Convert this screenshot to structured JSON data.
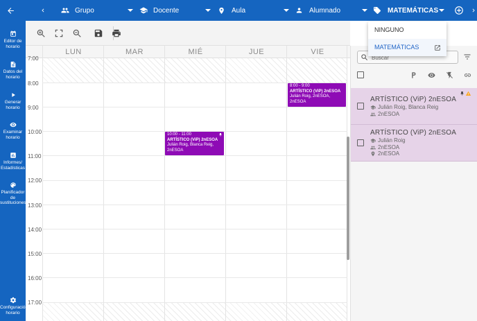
{
  "topbar": {
    "filters": [
      {
        "label": "Grupo",
        "icon": "group-icon"
      },
      {
        "label": "Docente",
        "icon": "school-icon"
      },
      {
        "label": "Aula",
        "icon": "location-pin-icon"
      },
      {
        "label": "Alumnado",
        "icon": "person-icon"
      },
      {
        "label": "MATEMÁTICAS",
        "icon": "tag-icon"
      }
    ]
  },
  "sidebar": {
    "items": [
      {
        "label": "Editor de\nhorario",
        "icon": "calendar-icon"
      },
      {
        "label": "Datos del\nhorario",
        "icon": "document-icon"
      },
      {
        "label": "Generar\nhorario",
        "icon": "play-icon"
      },
      {
        "label": "Examinar\nhorario",
        "icon": "eye-icon"
      },
      {
        "label": "Informes/\nEstadísticas",
        "icon": "chart-icon"
      },
      {
        "label": "Planificador\nde\nsustituciones",
        "icon": "palette-icon"
      },
      {
        "label": "Configuración\nhorario",
        "icon": "gear-icon"
      }
    ]
  },
  "calendar": {
    "days": [
      "LUN",
      "MAR",
      "MIÉ",
      "JUE",
      "VIE"
    ],
    "times": [
      "7:00",
      "8:00",
      "9:00",
      "10:00",
      "11:00",
      "12:00",
      "13:00",
      "14:00",
      "15:00",
      "16:00",
      "17:00"
    ],
    "events": [
      {
        "time": "8:00 - 9:00",
        "title": "ARTÍSTICO (ViP) 2nESOA",
        "details": "Julián Roig, 2nESOA, 2nESOA",
        "pinned": false
      },
      {
        "time": "10:00 - 11:00",
        "title": "ARTÍSTICO (ViP) 2nESOA",
        "details": "Julián Roig, Blanca Reig,",
        "details2": "2nESOA",
        "pinned": true
      }
    ]
  },
  "panel": {
    "search_placeholder": "Buscar",
    "header_icons": [
      "parking-p-icon",
      "eye-icon",
      "flash-off-icon",
      "link-icon"
    ],
    "cards": [
      {
        "title": "ARTÍSTICO (ViP) 2nESOA",
        "teacher": "Julián Roig, Blanca Reig",
        "group": "2nESOA",
        "pinned": true,
        "warning": true
      },
      {
        "title": "ARTÍSTICO (ViP) 2nESOA",
        "teacher": "Julián Roig",
        "group": "2nESOA",
        "room": "2nESOA",
        "pinned": false,
        "warning": false
      }
    ]
  },
  "dropdown": {
    "items": [
      {
        "label": "NINGUNO"
      },
      {
        "label": "MATEMÁTICAS"
      }
    ]
  },
  "colors": {
    "primary": "#1565c0",
    "event": "#8e0bb5",
    "card": "#e6d3e8",
    "warning": "#f9a825"
  }
}
